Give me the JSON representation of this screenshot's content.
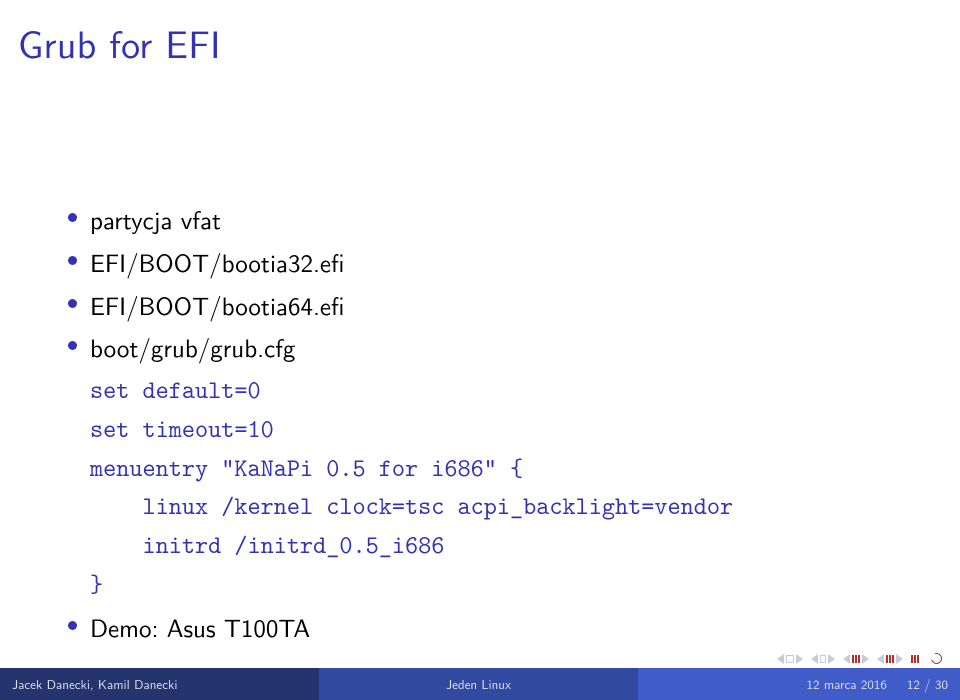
{
  "title": "Grub for EFI",
  "bullets": {
    "b1": "partycja vfat",
    "b2": "EFI/BOOT/bootia32.efi",
    "b3": "EFI/BOOT/bootia64.efi",
    "b4": "boot/grub/grub.cfg",
    "b5": "Demo: Asus T100TA"
  },
  "code": "set default=0\nset timeout=10\nmenuentry \"KaNaPi 0.5 for i686\" {\n    linux /kernel clock=tsc acpi_backlight=vendor\n    initrd /initrd_0.5_i686\n}",
  "footer": {
    "left": "Jacek Danecki, Kamil Danecki",
    "center": "Jeden Linux",
    "date": "12 marca 2016",
    "page": "12 / 30"
  }
}
